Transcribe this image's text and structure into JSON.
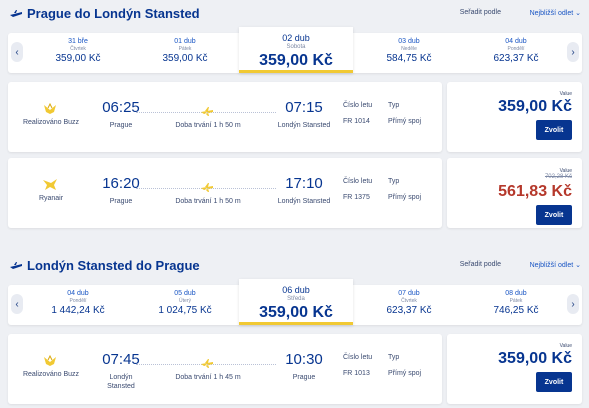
{
  "outbound": {
    "title": "Prague do Londýn Stansted",
    "sort_label": "Seřadit podle",
    "sort_value": "Nejbližší odlet",
    "days": [
      {
        "date": "31 bře",
        "weekday": "Čtvrtek",
        "price": "359,00 Kč"
      },
      {
        "date": "01 dub",
        "weekday": "Pátek",
        "price": "359,00 Kč"
      },
      {
        "date": "02 dub",
        "weekday": "Sobota",
        "price": "359,00 Kč"
      },
      {
        "date": "03 dub",
        "weekday": "Neděle",
        "price": "584,75 Kč"
      },
      {
        "date": "04 dub",
        "weekday": "Pondělí",
        "price": "623,37 Kč"
      }
    ],
    "flights": [
      {
        "operator": "Realizováno Buzz",
        "dep_time": "06:25",
        "dep_city": "Prague",
        "duration": "Doba trvání 1 h 50 m",
        "arr_time": "07:15",
        "arr_city": "Londýn Stansted",
        "flight_label": "Číslo letu",
        "flight_no": "FR 1014",
        "type_label": "Typ",
        "type": "Přímý spoj",
        "fare": "Value",
        "old_price": "",
        "price": "359,00 Kč",
        "button": "Zvolit"
      },
      {
        "operator": "Ryanair",
        "dep_time": "16:20",
        "dep_city": "Prague",
        "duration": "Doba trvání 1 h 50 m",
        "arr_time": "17:10",
        "arr_city": "Londýn Stansted",
        "flight_label": "Číslo letu",
        "flight_no": "FR 1375",
        "type_label": "Typ",
        "type": "Přímý spoj",
        "fare": "Value",
        "old_price": "702,28 Kč",
        "price": "561,83 Kč",
        "button": "Zvolit"
      }
    ]
  },
  "inbound": {
    "title": "Londýn Stansted do Prague",
    "sort_label": "Seřadit podle",
    "sort_value": "Nejbližší odlet",
    "days": [
      {
        "date": "04 dub",
        "weekday": "Pondělí",
        "price": "1 442,24 Kč"
      },
      {
        "date": "05 dub",
        "weekday": "Úterý",
        "price": "1 024,75 Kč"
      },
      {
        "date": "06 dub",
        "weekday": "Středa",
        "price": "359,00 Kč"
      },
      {
        "date": "07 dub",
        "weekday": "Čtvrtek",
        "price": "623,37 Kč"
      },
      {
        "date": "08 dub",
        "weekday": "Pátek",
        "price": "746,25 Kč"
      }
    ],
    "flights": [
      {
        "operator": "Realizováno Buzz",
        "dep_time": "07:45",
        "dep_city": "Londýn Stansted",
        "duration": "Doba trvání 1 h 45 m",
        "arr_time": "10:30",
        "arr_city": "Prague",
        "flight_label": "Číslo letu",
        "flight_no": "FR 1013",
        "type_label": "Typ",
        "type": "Přímý spoj",
        "fare": "Value",
        "old_price": "",
        "price": "359,00 Kč",
        "button": "Zvolit"
      }
    ]
  },
  "colors": {
    "brand": "#073590",
    "accent": "#f1c933",
    "sale": "#b5382b",
    "link": "#1a56c4"
  },
  "icons": {
    "header_plane": "plane-icon",
    "logo_buzz": "buzz-logo-icon",
    "logo_ryanair": "ryanair-harp-icon",
    "route_plane": "plane-icon",
    "arrow_left": "chevron-left-icon",
    "arrow_right": "chevron-right-icon",
    "sort_chevron": "chevron-down-icon"
  }
}
